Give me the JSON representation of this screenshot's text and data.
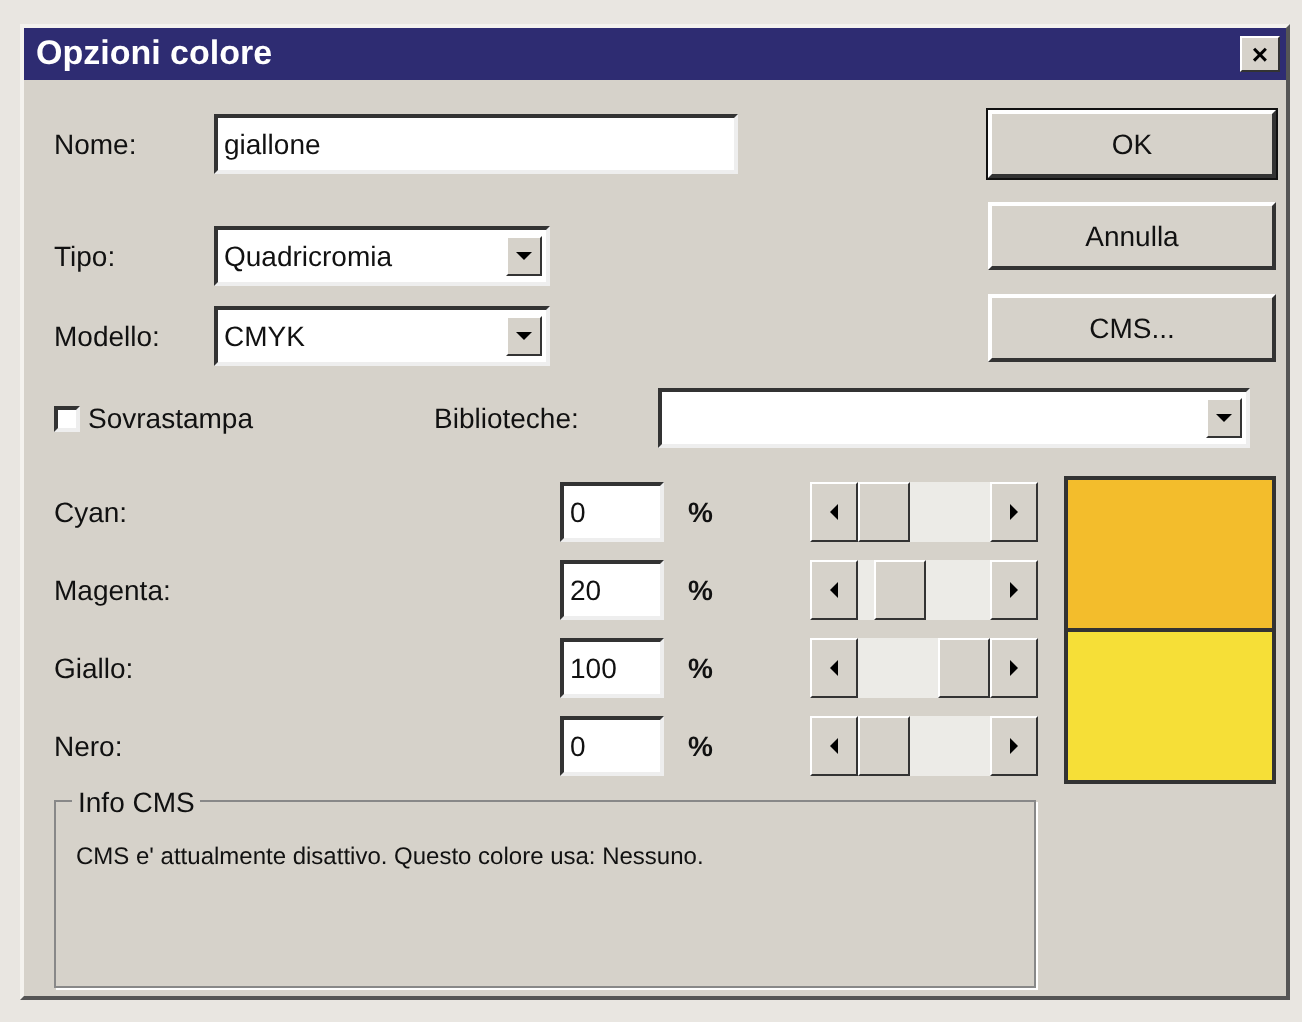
{
  "window": {
    "title": "Opzioni colore",
    "close": "×"
  },
  "name": {
    "label": "Nome:",
    "value": "giallone"
  },
  "type": {
    "label": "Tipo:",
    "value": "Quadricromia"
  },
  "model": {
    "label": "Modello:",
    "value": "CMYK"
  },
  "buttons": [
    "OK",
    "Annulla",
    "CMS..."
  ],
  "overprint": {
    "label": "Sovrastampa",
    "checked": false
  },
  "libraries": {
    "label": "Biblioteche:"
  },
  "channels": [
    {
      "label": "Cyan:",
      "value": "0",
      "unit": "%",
      "level": 0
    },
    {
      "label": "Magenta:",
      "value": "20",
      "unit": "%",
      "level": 0.2
    },
    {
      "label": "Giallo:",
      "value": "100",
      "unit": "%",
      "level": 1
    },
    {
      "label": "Nero:",
      "value": "0",
      "unit": "%",
      "level": 0
    }
  ],
  "swatches": [
    {
      "color": "#f3bd2c"
    },
    {
      "color": "#f6df37"
    }
  ],
  "info": {
    "title": "Info CMS",
    "text": "CMS e' attualmente disattivo. Questo colore usa: Nessuno."
  }
}
